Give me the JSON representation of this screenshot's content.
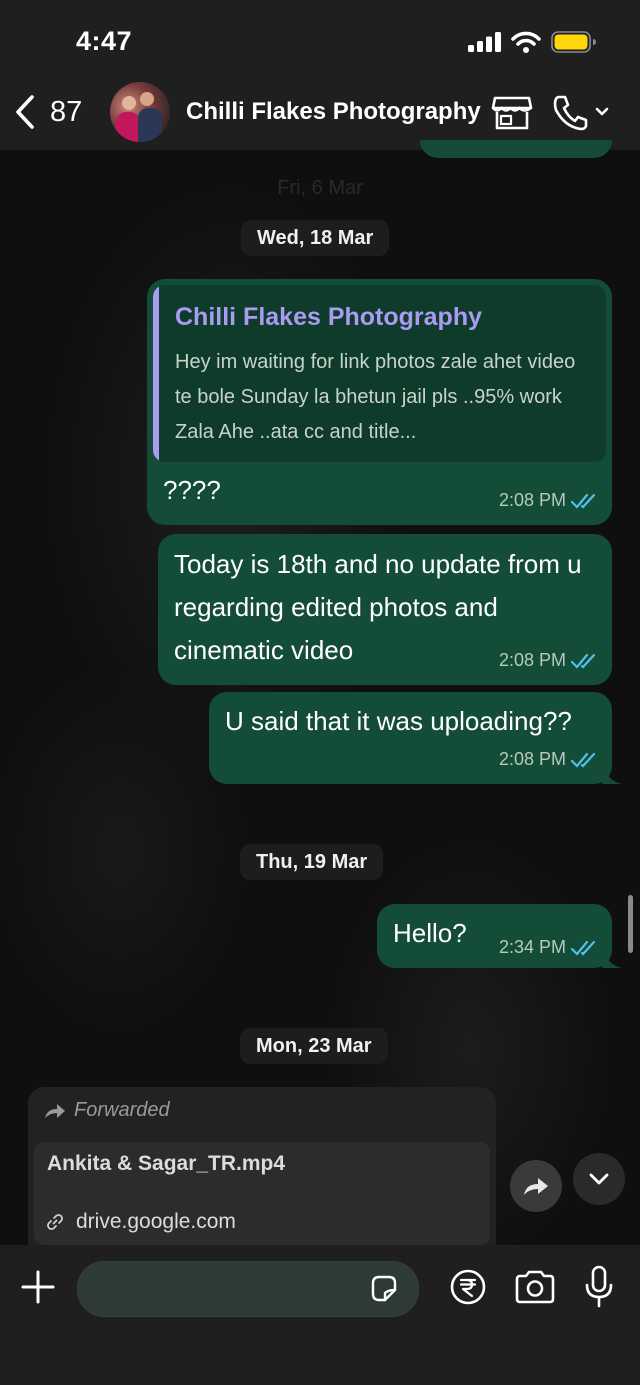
{
  "status_bar": {
    "time": "4:47"
  },
  "header": {
    "back_count": "87",
    "contact_name": "Chilli Flakes Photography"
  },
  "faded_date": "Fri, 6 Mar",
  "date_separators": [
    "Wed, 18 Mar",
    "Thu, 19 Mar",
    "Mon, 23 Mar"
  ],
  "messages": [
    {
      "quoted_name": "Chilli Flakes Photography",
      "quoted_text": "Hey im waiting for link photos zale ahet video te bole Sunday la bhetun jail pls ..95% work Zala Ahe ..ata cc and title...",
      "text": "????",
      "time": "2:08 PM"
    },
    {
      "text": "Today is 18th and no update from u regarding edited photos and cinematic video",
      "time": "2:08 PM"
    },
    {
      "text": "U said that it was uploading??",
      "time": "2:08 PM"
    },
    {
      "text": "Hello?",
      "time": "2:34 PM"
    }
  ],
  "forwarded_message": {
    "label": "Forwarded",
    "link_title": "Ankita & Sagar_TR.mp4",
    "link_domain": "drive.google.com"
  },
  "composer": {
    "placeholder": ""
  },
  "colors": {
    "outgoing_bubble": "#144d37",
    "quote_accent": "#a99bf2",
    "read_ticks": "#53bdeb",
    "header_bg": "#1f1f1f"
  }
}
